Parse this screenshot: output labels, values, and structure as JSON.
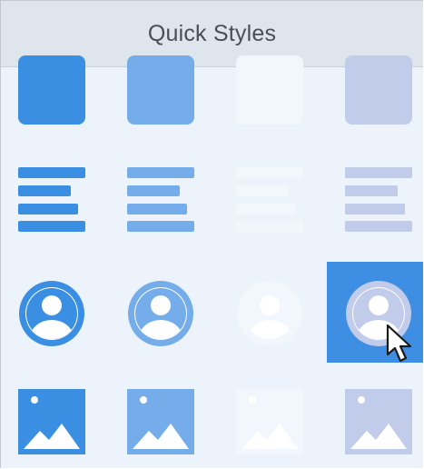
{
  "panel": {
    "title": "Quick Styles"
  },
  "colors": {
    "style_1": "#3b8fe2",
    "style_2": "#74adea",
    "style_3": "#f2f7fd",
    "style_4": "#c1cbea",
    "selected_highlight": "#3e8ee3",
    "panel_background": "#ecf3fb",
    "header_background": "#dee5ec"
  },
  "grid": {
    "rows": [
      "square",
      "text-lines",
      "person",
      "image"
    ],
    "columns": [
      "style-1",
      "style-2",
      "style-3",
      "style-4"
    ],
    "selected": {
      "row": "person",
      "column": "style-4"
    }
  },
  "icons": {
    "square": "square-icon",
    "text-lines": "text-lines-icon",
    "person": "person-icon",
    "image": "image-icon",
    "cursor": "mouse-pointer-icon"
  }
}
